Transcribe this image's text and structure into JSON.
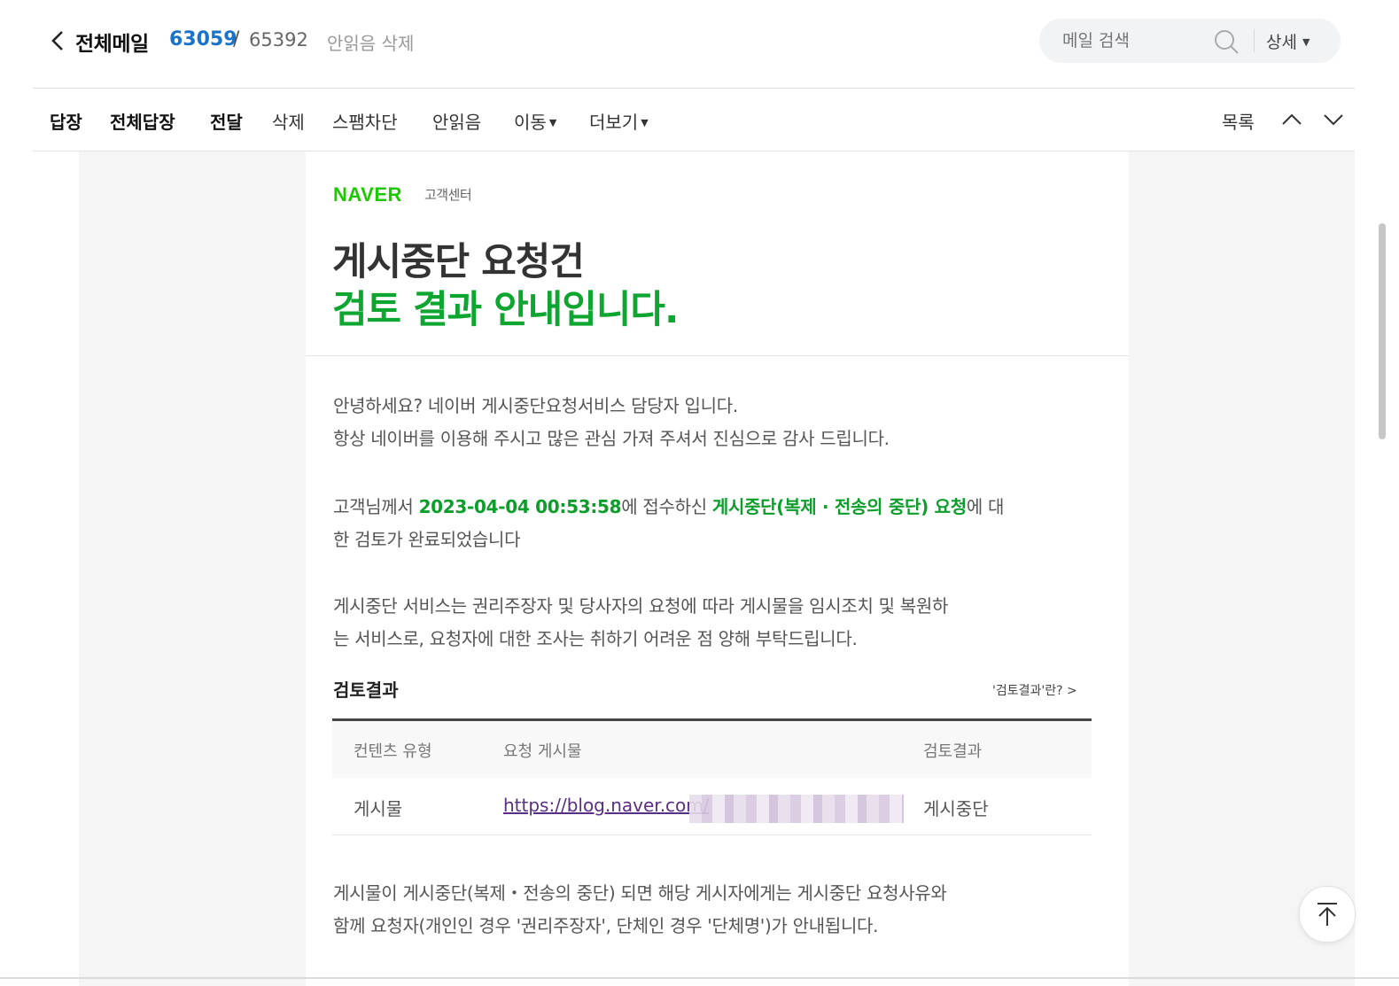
{
  "header": {
    "mailbox_title": "전체메일",
    "unread_count": "63059",
    "separator": "/",
    "total_count": "65392",
    "delete_unread": "안읽음 삭제",
    "search_placeholder": "메일 검색",
    "detail_label": "상세",
    "icons": {
      "back": "chevron-left-icon",
      "search": "search-icon",
      "detail_caret": "caret-down-icon"
    }
  },
  "toolbar": {
    "reply": "답장",
    "reply_all": "전체답장",
    "forward": "전달",
    "delete": "삭제",
    "spam_block": "스팸차단",
    "mark_unread": "안읽음",
    "move": "이동",
    "more": "더보기",
    "list": "목록",
    "icons": {
      "prev": "chevron-up-icon",
      "next": "chevron-down-icon"
    }
  },
  "mail": {
    "logo": "NAVER",
    "logo_sub": "고객센터",
    "headline_line1": "게시중단 요청건",
    "headline_line2": "검토 결과 안내입니다.",
    "para1_line1": "안녕하세요? 네이버 게시중단요청서비스 담당자 입니다.",
    "para1_line2": "항상 네이버를 이용해 주시고 많은 관심 가져 주셔서 진심으로 감사 드립니다.",
    "para2_prefix": "고객님께서 ",
    "para2_datetime": "2023-04-04 00:53:58",
    "para2_mid": "에 접수하신 ",
    "para2_request": "게시중단(복제 · 전송의 중단) 요청",
    "para2_suffix": "에 대",
    "para2_line2": "한 검토가 완료되었습니다",
    "para3_line1": "게시중단 서비스는 권리주장자 및 당사자의 요청에 따라 게시물을 임시조치 및 복원하",
    "para3_line2": "는 서비스로, 요청자에 대한 조사는 취하기 어려운 점 양해 부탁드립니다.",
    "result_title": "검토결과",
    "result_link": "'검토결과'란? >",
    "table": {
      "headers": [
        "컨텐츠 유형",
        "요청 게시물",
        "검토결과"
      ],
      "rows": [
        {
          "type": "게시물",
          "url": "https://blog.naver.com/",
          "result": "게시중단"
        }
      ]
    },
    "para4_line1": "게시물이 게시중단(복제・전송의 중단) 되면 해당 게시자에게는 게시중단 요청사유와",
    "para4_line2": "함께 요청자(개인인 경우 '권리주장자', 단체인 경우 '단체명')가  안내됩니다."
  },
  "colors": {
    "accent_blue": "#1a73c9",
    "naver_green": "#1ec800",
    "headline_green": "#0ea531",
    "link_purple": "#5a2e84"
  },
  "floating": {
    "to_top_icon": "arrow-to-top-icon"
  }
}
